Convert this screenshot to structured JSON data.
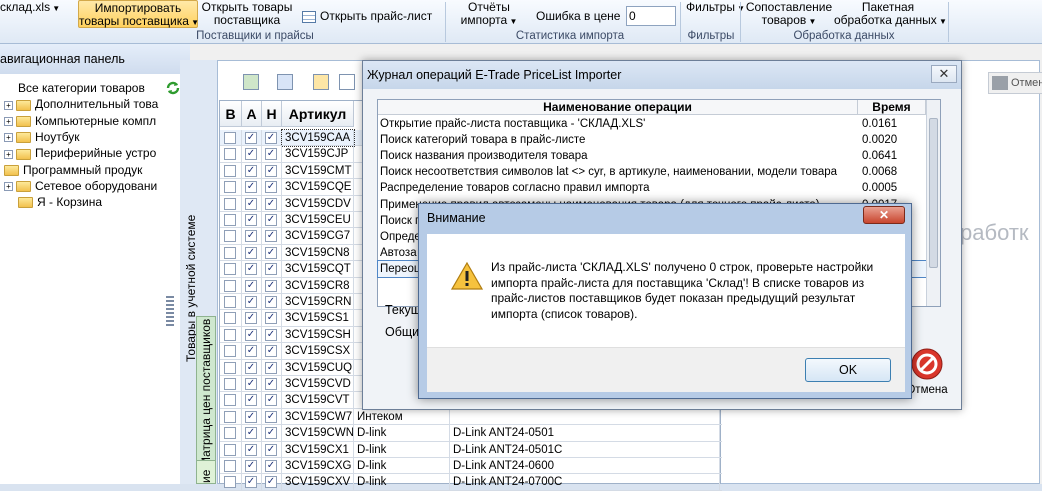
{
  "ribbon": {
    "btn_file": "склад.xls",
    "btn_import": [
      "Импортировать",
      "товары поставщика"
    ],
    "btn_open_goods": [
      "Открыть товары",
      "поставщика"
    ],
    "btn_open_pricelist": "Открыть прайс-лист",
    "group_suppliers": "Поставщики и прайсы",
    "btn_reports": [
      "Отчёты",
      "импорта"
    ],
    "lbl_price_error": "Ошибка в цене",
    "price_error_value": "0",
    "group_stats": "Статистика импорта",
    "btn_filters": "Фильтры",
    "group_filters": "Фильтры",
    "btn_match": [
      "Сопоставление",
      "товаров"
    ],
    "btn_batch": [
      "Пакетная",
      "обработка данных"
    ],
    "group_data": "Обработка данных"
  },
  "nav": {
    "title": "авигационная панель",
    "items": [
      {
        "label": "Все категории товаров",
        "expand": false,
        "indent": 18
      },
      {
        "label": "Дополнительный това",
        "expand": true,
        "indent": 4
      },
      {
        "label": "Компьютерные компл",
        "expand": true,
        "indent": 4
      },
      {
        "label": "Ноутбук",
        "expand": true,
        "indent": 4
      },
      {
        "label": "Периферийные устро",
        "expand": true,
        "indent": 4
      },
      {
        "label": "Программный продук",
        "expand": false,
        "indent": 4
      },
      {
        "label": "Сетевое оборудовани",
        "expand": true,
        "indent": 4
      },
      {
        "label": "Я - Корзина",
        "expand": false,
        "indent": 18
      }
    ]
  },
  "side_tabs": {
    "goods_in_system": "Товары в учетной системе",
    "price_matrix": "Матрица цен поставщиков",
    "bottom_tab": "ие"
  },
  "grid": {
    "headers": [
      "В",
      "А",
      "Н",
      "Артикул"
    ],
    "rows": [
      {
        "article": "3CV159CAA",
        "brand": "",
        "model": "",
        "a": true,
        "n": true
      },
      {
        "article": "3CV159CJP",
        "brand": "",
        "model": "",
        "a": true,
        "n": true
      },
      {
        "article": "3CV159CMT",
        "brand": "",
        "model": "",
        "a": true,
        "n": true
      },
      {
        "article": "3CV159CQE",
        "brand": "",
        "model": "",
        "a": true,
        "n": true
      },
      {
        "article": "3CV159CDV",
        "brand": "",
        "model": "",
        "a": true,
        "n": true
      },
      {
        "article": "3CV159CEU",
        "brand": "",
        "model": "",
        "a": true,
        "n": true
      },
      {
        "article": "3CV159CG7",
        "brand": "",
        "model": "",
        "a": true,
        "n": true
      },
      {
        "article": "3CV159CN8",
        "brand": "",
        "model": "",
        "a": true,
        "n": true
      },
      {
        "article": "3CV159CQT",
        "brand": "",
        "model": "",
        "a": true,
        "n": true
      },
      {
        "article": "3CV159CR8",
        "brand": "",
        "model": "",
        "a": true,
        "n": true
      },
      {
        "article": "3CV159CRN",
        "brand": "",
        "model": "",
        "a": true,
        "n": true
      },
      {
        "article": "3CV159CS1",
        "brand": "",
        "model": "",
        "a": true,
        "n": true
      },
      {
        "article": "3CV159CSH",
        "brand": "",
        "model": "",
        "a": true,
        "n": true
      },
      {
        "article": "3CV159CSX",
        "brand": "",
        "model": "",
        "a": true,
        "n": true
      },
      {
        "article": "3CV159CUQ",
        "brand": "",
        "model": "",
        "a": true,
        "n": true
      },
      {
        "article": "3CV159CVD",
        "brand": "",
        "model": "",
        "a": true,
        "n": true
      },
      {
        "article": "3CV159CVT",
        "brand": "",
        "model": "",
        "a": true,
        "n": true
      },
      {
        "article": "3CV159CW7",
        "brand": "Интеком",
        "model": "",
        "a": true,
        "n": true
      },
      {
        "article": "3CV159CWN",
        "brand": "D-link",
        "model": "D-Link ANT24-0501",
        "a": true,
        "n": true
      },
      {
        "article": "3CV159CX1",
        "brand": "D-link",
        "model": "D-Link ANT24-0501C",
        "a": true,
        "n": true
      },
      {
        "article": "3CV159CXG",
        "brand": "D-link",
        "model": "D-Link ANT24-0600",
        "a": true,
        "n": true
      },
      {
        "article": "3CV159CXV",
        "brand": "D-link",
        "model": "D-Link ANT24-0700C",
        "a": true,
        "n": true
      }
    ]
  },
  "journal": {
    "title": "Журнал операций E-Trade PriceList Importer",
    "col_name": "Наименование операции",
    "col_time": "Время",
    "ops": [
      {
        "name": "Открытие прайс-листа поставщика - 'СКЛАД.XLS'",
        "time": "0.0161"
      },
      {
        "name": "Поиск категорий товара в прайс-листе",
        "time": "0.0020"
      },
      {
        "name": "Поиск названия производителя товара",
        "time": "0.0641"
      },
      {
        "name": "Поиск несоответствия символов lat <> cyr, в артикуле, наименовании, модели товара",
        "time": "0.0068"
      },
      {
        "name": "Распределение товаров согласно правил импорта",
        "time": "0.0005"
      },
      {
        "name": "Применение правил автозамены наименования товара (для точного прайс-листа)",
        "time": "0.0017"
      },
      {
        "name": "Поиск п",
        "time": ""
      },
      {
        "name": "Опреде",
        "time": ""
      },
      {
        "name": "Автоза",
        "time": ""
      },
      {
        "name": "Переоц",
        "time": ""
      }
    ],
    "lbl_current": "Текущ",
    "lbl_total": "Общи",
    "cancel_label": "Отмена"
  },
  "background": {
    "right_text": "работк",
    "top_right_btn": "Отмен"
  },
  "alert": {
    "title": "Внимание",
    "message": "Из прайс-листа 'СКЛАД.XLS' получено 0 строк, проверьте настройки импорта прайс-листа для поставщика 'Склад'! В списке товаров из прайс-листов поставщиков будет показан предыдущий результат импорта (список товаров).",
    "ok_label": "OK",
    "close_label": "✕"
  }
}
